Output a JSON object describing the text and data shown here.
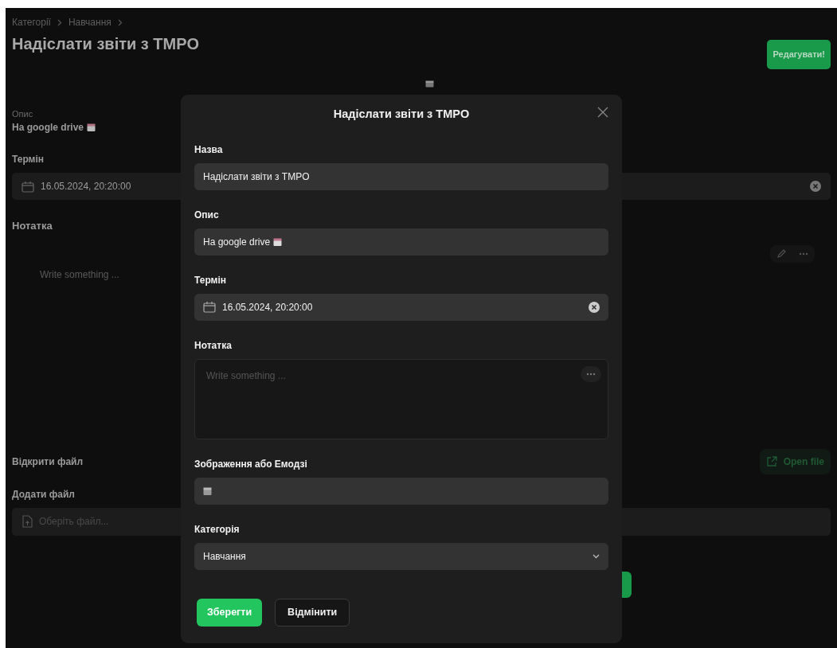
{
  "breadcrumb": [
    {
      "label": "Категорії"
    },
    {
      "label": "Навчання"
    }
  ],
  "page": {
    "title": "Надіслати звіти з TMPO",
    "edit_button": "Редагувати!",
    "description_label": "Опис",
    "description": "На google drive",
    "deadline_label": "Термін",
    "deadline": "16.05.2024, 20:20:00",
    "note_label": "Нотатка",
    "note_placeholder": "Write something ...",
    "open_file_label": "Відкрити файл",
    "open_file_button": "Open file",
    "add_file_label": "Додати файл",
    "file_placeholder": "Оберіть файл..."
  },
  "modal": {
    "title": "Надіслати звіти з TMPO",
    "fields": [
      {
        "kind": "text",
        "label": "Назва",
        "value": "Надіслати звіти з TMPO"
      },
      {
        "kind": "description",
        "label": "Опис",
        "value": "На google drive"
      },
      {
        "kind": "date",
        "label": "Термін",
        "value": "16.05.2024, 20:20:00"
      },
      {
        "kind": "editor",
        "label": "Нотатка",
        "placeholder": "Write something ..."
      },
      {
        "kind": "emoji",
        "label": "Зображення або Емодзі"
      },
      {
        "kind": "select",
        "label": "Категорія",
        "value": "Навчання"
      }
    ],
    "buttons": [
      {
        "kind": "primary",
        "label": "Зберегти"
      },
      {
        "kind": "secondary",
        "label": "Відмінити"
      }
    ]
  }
}
